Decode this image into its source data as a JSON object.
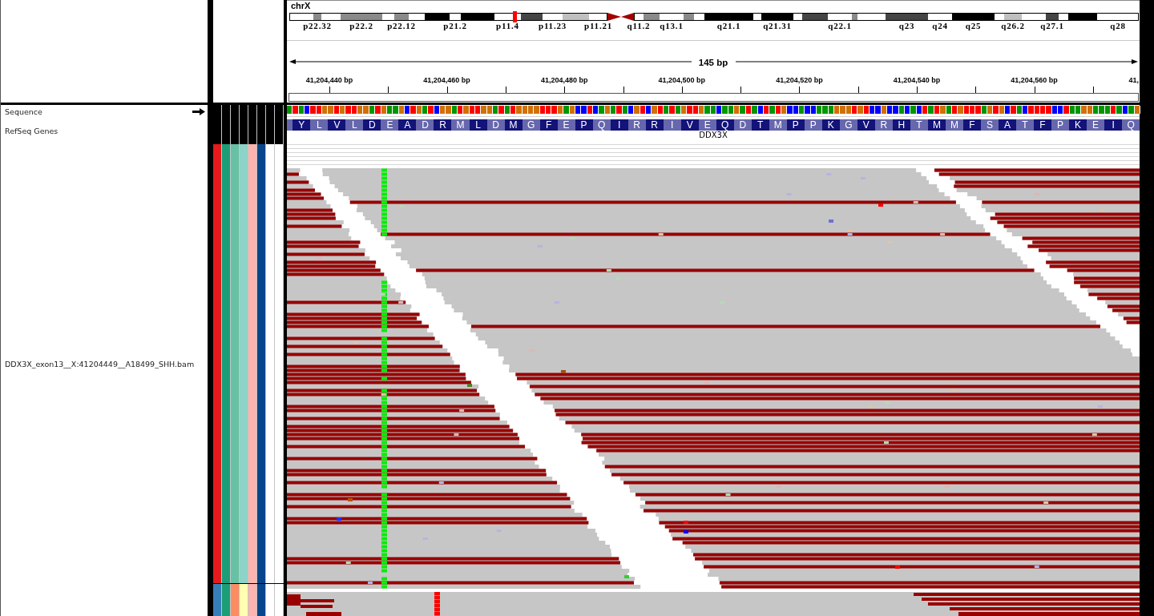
{
  "chromosome": "chrX",
  "ideogram": {
    "bands": [
      {
        "kind": "gneg"
      },
      {
        "kind": "gpos50",
        "label": "p22.32"
      },
      {
        "kind": "gneg"
      },
      {
        "kind": "gpos50",
        "label": "p22.2"
      },
      {
        "kind": "gneg"
      },
      {
        "kind": "gpos50",
        "label": "p22.12"
      },
      {
        "kind": "gneg"
      },
      {
        "kind": "gpos100"
      },
      {
        "kind": "gneg",
        "label": "p21.2"
      },
      {
        "kind": "gpos100"
      },
      {
        "kind": "gneg",
        "label": "p11.4"
      },
      {
        "kind": "gpos75"
      },
      {
        "kind": "gneg",
        "label": "p11.23"
      },
      {
        "kind": "gpos25"
      },
      {
        "kind": "gneg",
        "label": "p11.21"
      },
      {
        "kind": "acen"
      },
      {
        "kind": "acen"
      },
      {
        "kind": "gneg",
        "label": "q11.2"
      },
      {
        "kind": "gpos50"
      },
      {
        "kind": "gneg",
        "label": "q13.1"
      },
      {
        "kind": "gpos50"
      },
      {
        "kind": "gneg"
      },
      {
        "kind": "gpos100",
        "label": "q21.1"
      },
      {
        "kind": "gneg"
      },
      {
        "kind": "gpos100",
        "label": "q21.31"
      },
      {
        "kind": "gneg"
      },
      {
        "kind": "gpos75"
      },
      {
        "kind": "gneg",
        "label": "q22.1"
      },
      {
        "kind": "gpos50"
      },
      {
        "kind": "gneg"
      },
      {
        "kind": "gpos75",
        "label": "q23"
      },
      {
        "kind": "gneg",
        "label": "q24"
      },
      {
        "kind": "gpos100",
        "label": "q25"
      },
      {
        "kind": "gneg"
      },
      {
        "kind": "gpos25",
        "label": "q26.2"
      },
      {
        "kind": "gneg"
      },
      {
        "kind": "gpos75",
        "label": "q27.1"
      },
      {
        "kind": "gneg"
      },
      {
        "kind": "gpos100"
      },
      {
        "kind": "gneg",
        "label": "q28"
      }
    ]
  },
  "ruler": {
    "span": "145 bp",
    "tick_labels": [
      "41,204,440 bp",
      "41,204,460 bp",
      "41,204,480 bp",
      "41,204,500 bp",
      "41,204,520 bp",
      "41,204,540 bp",
      "41,204,560 bp",
      "41,"
    ]
  },
  "tracks": [
    {
      "kind": "sequence",
      "name": "Sequence",
      "forward_strand": true,
      "bases": [
        {
          "color": "#009600"
        },
        {
          "color": "#ff0000"
        },
        {
          "color": "#009600"
        },
        {
          "color": "#0000ff"
        },
        {
          "color": "#ff0000"
        },
        {
          "color": "#ff0000"
        },
        {
          "color": "#d17105"
        },
        {
          "color": "#d17105"
        },
        {
          "color": "#ff0000"
        },
        {
          "color": "#d17105"
        },
        {
          "color": "#ff0000"
        },
        {
          "color": "#ff0000"
        },
        {
          "color": "#d17105"
        },
        {
          "color": "#d17105"
        },
        {
          "color": "#009600"
        },
        {
          "color": "#ff0000"
        },
        {
          "color": "#d17105"
        },
        {
          "color": "#009600"
        },
        {
          "color": "#009600"
        },
        {
          "color": "#d17105"
        },
        {
          "color": "#0000ff"
        },
        {
          "color": "#ff0000"
        },
        {
          "color": "#d17105"
        },
        {
          "color": "#009600"
        },
        {
          "color": "#ff0000"
        },
        {
          "color": "#0000ff"
        },
        {
          "color": "#d17105"
        },
        {
          "color": "#d17105"
        },
        {
          "color": "#009600"
        },
        {
          "color": "#ff0000"
        },
        {
          "color": "#d17105"
        },
        {
          "color": "#ff0000"
        },
        {
          "color": "#ff0000"
        },
        {
          "color": "#d17105"
        },
        {
          "color": "#d17105"
        },
        {
          "color": "#009600"
        },
        {
          "color": "#ff0000"
        },
        {
          "color": "#009600"
        },
        {
          "color": "#ff0000"
        },
        {
          "color": "#d17105"
        },
        {
          "color": "#d17105"
        },
        {
          "color": "#d17105"
        },
        {
          "color": "#d17105"
        },
        {
          "color": "#ff0000"
        },
        {
          "color": "#ff0000"
        },
        {
          "color": "#ff0000"
        },
        {
          "color": "#d17105"
        },
        {
          "color": "#009600"
        },
        {
          "color": "#d17105"
        },
        {
          "color": "#0000ff"
        },
        {
          "color": "#0000ff"
        },
        {
          "color": "#ff0000"
        },
        {
          "color": "#0000ff"
        },
        {
          "color": "#009600"
        },
        {
          "color": "#d17105"
        },
        {
          "color": "#009600"
        },
        {
          "color": "#ff0000"
        },
        {
          "color": "#009600"
        },
        {
          "color": "#0000ff"
        },
        {
          "color": "#d17105"
        },
        {
          "color": "#ff0000"
        },
        {
          "color": "#0000ff"
        },
        {
          "color": "#d17105"
        },
        {
          "color": "#ff0000"
        },
        {
          "color": "#009600"
        },
        {
          "color": "#ff0000"
        },
        {
          "color": "#009600"
        },
        {
          "color": "#d17105"
        },
        {
          "color": "#ff0000"
        },
        {
          "color": "#ff0000"
        },
        {
          "color": "#d17105"
        },
        {
          "color": "#009600"
        },
        {
          "color": "#009600"
        },
        {
          "color": "#0000ff"
        },
        {
          "color": "#009600"
        },
        {
          "color": "#009600"
        },
        {
          "color": "#d17105"
        },
        {
          "color": "#009600"
        },
        {
          "color": "#ff0000"
        },
        {
          "color": "#009600"
        },
        {
          "color": "#0000ff"
        },
        {
          "color": "#ff0000"
        },
        {
          "color": "#009600"
        },
        {
          "color": "#ff0000"
        },
        {
          "color": "#d17105"
        },
        {
          "color": "#0000ff"
        },
        {
          "color": "#0000ff"
        },
        {
          "color": "#009600"
        },
        {
          "color": "#0000ff"
        },
        {
          "color": "#0000ff"
        },
        {
          "color": "#009600"
        },
        {
          "color": "#009600"
        },
        {
          "color": "#009600"
        },
        {
          "color": "#d17105"
        },
        {
          "color": "#d17105"
        },
        {
          "color": "#d17105"
        },
        {
          "color": "#ff0000"
        },
        {
          "color": "#d17105"
        },
        {
          "color": "#ff0000"
        },
        {
          "color": "#0000ff"
        },
        {
          "color": "#0000ff"
        },
        {
          "color": "#d17105"
        },
        {
          "color": "#0000ff"
        },
        {
          "color": "#0000ff"
        },
        {
          "color": "#009600"
        },
        {
          "color": "#0000ff"
        },
        {
          "color": "#009600"
        },
        {
          "color": "#0000ff"
        },
        {
          "color": "#ff0000"
        },
        {
          "color": "#009600"
        },
        {
          "color": "#ff0000"
        },
        {
          "color": "#d17105"
        },
        {
          "color": "#009600"
        },
        {
          "color": "#ff0000"
        },
        {
          "color": "#d17105"
        },
        {
          "color": "#ff0000"
        },
        {
          "color": "#ff0000"
        },
        {
          "color": "#ff0000"
        },
        {
          "color": "#009600"
        },
        {
          "color": "#d17105"
        },
        {
          "color": "#ff0000"
        },
        {
          "color": "#d17105"
        },
        {
          "color": "#0000ff"
        },
        {
          "color": "#ff0000"
        },
        {
          "color": "#009600"
        },
        {
          "color": "#0000ff"
        },
        {
          "color": "#ff0000"
        },
        {
          "color": "#ff0000"
        },
        {
          "color": "#ff0000"
        },
        {
          "color": "#ff0000"
        },
        {
          "color": "#0000ff"
        },
        {
          "color": "#0000ff"
        },
        {
          "color": "#ff0000"
        },
        {
          "color": "#009600"
        },
        {
          "color": "#009600"
        },
        {
          "color": "#d17105"
        },
        {
          "color": "#d17105"
        },
        {
          "color": "#009600"
        },
        {
          "color": "#009600"
        },
        {
          "color": "#009600"
        },
        {
          "color": "#ff0000"
        },
        {
          "color": "#009600"
        },
        {
          "color": "#0000ff"
        },
        {
          "color": "#009600"
        },
        {
          "color": "#d17105"
        }
      ]
    },
    {
      "kind": "genes",
      "name": "RefSeq Genes",
      "features": [
        {
          "name": "DDX3X",
          "amino_acids": [
            "Y",
            "L",
            "V",
            "L",
            "D",
            "E",
            "A",
            "D",
            "R",
            "M",
            "L",
            "D",
            "M",
            "G",
            "F",
            "E",
            "P",
            "Q",
            "I",
            "R",
            "R",
            "I",
            "V",
            "E",
            "Q",
            "D",
            "T",
            "M",
            "P",
            "P",
            "K",
            "G",
            "V",
            "R",
            "H",
            "T",
            "M",
            "M",
            "F",
            "S",
            "A",
            "T",
            "F",
            "P",
            "K",
            "E",
            "I",
            "Q"
          ]
        }
      ]
    },
    {
      "kind": "alignment",
      "name": "DDX3X_exon13__X:41204449__A18499_SHH.bam",
      "attributes": [
        {
          "color": "#e41a1c"
        },
        {
          "color": "#1b9e77"
        },
        {
          "color": "#66c2a5"
        },
        {
          "color": "#8dd3c7"
        },
        {
          "color": "#fbb4ae"
        },
        {
          "color": "#08468c"
        },
        {
          "color": "#ffffff"
        },
        {
          "color": "#ffffff"
        }
      ]
    },
    {
      "kind": "alignment",
      "attributes": [
        {
          "color": "#377eb8"
        },
        {
          "color": "#1b9e77"
        },
        {
          "color": "#fc8d62"
        },
        {
          "color": "#ffffb3"
        },
        {
          "color": "#fbb4ae"
        },
        {
          "color": "#08468c"
        },
        {
          "color": "#ffffff"
        },
        {
          "color": "#ffffff"
        }
      ]
    }
  ]
}
